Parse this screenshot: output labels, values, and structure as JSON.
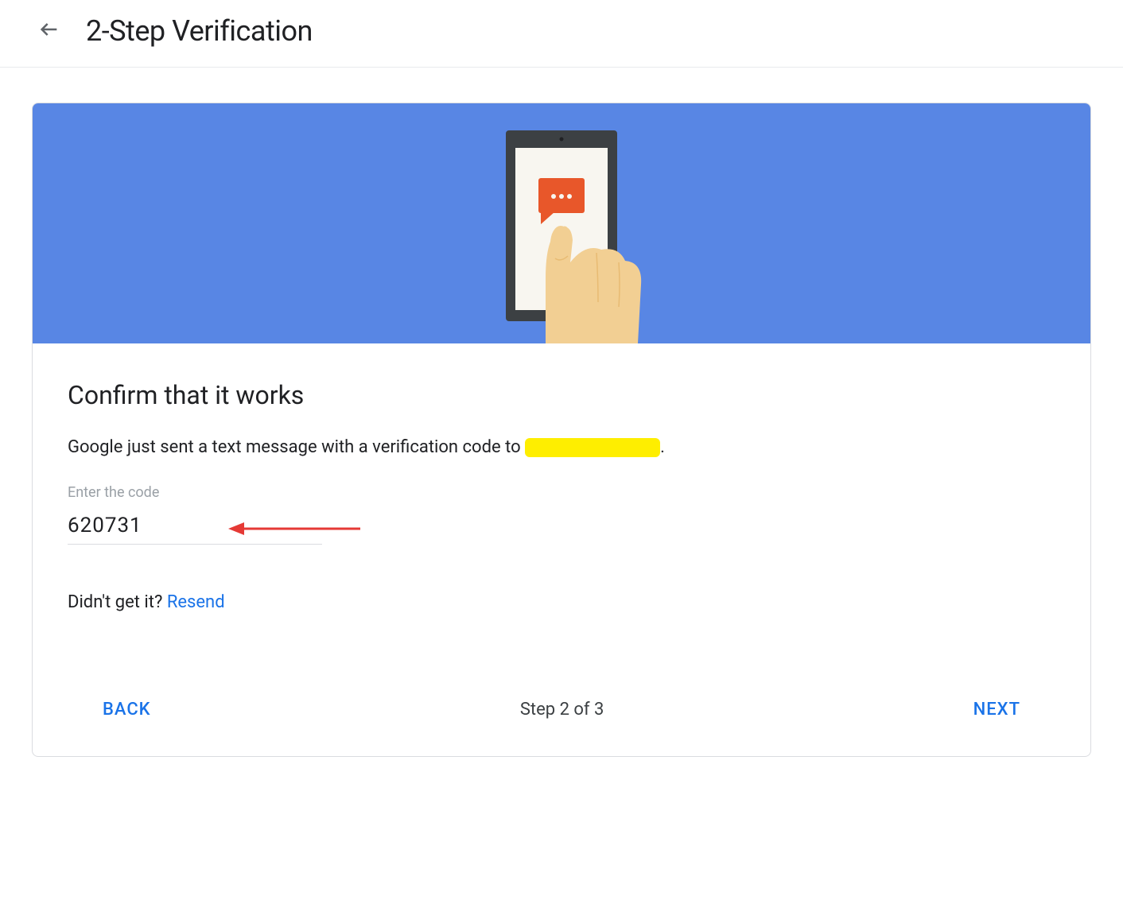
{
  "header": {
    "title": "2-Step Verification"
  },
  "card": {
    "title": "Confirm that it works",
    "description_prefix": "Google just sent a text message with a verification code to ",
    "description_suffix": ".",
    "input": {
      "label": "Enter the code",
      "value": "620731"
    },
    "resend": {
      "prompt": "Didn't get it? ",
      "link": "Resend"
    },
    "footer": {
      "back": "BACK",
      "step": "Step 2 of 3",
      "next": "NEXT"
    }
  }
}
